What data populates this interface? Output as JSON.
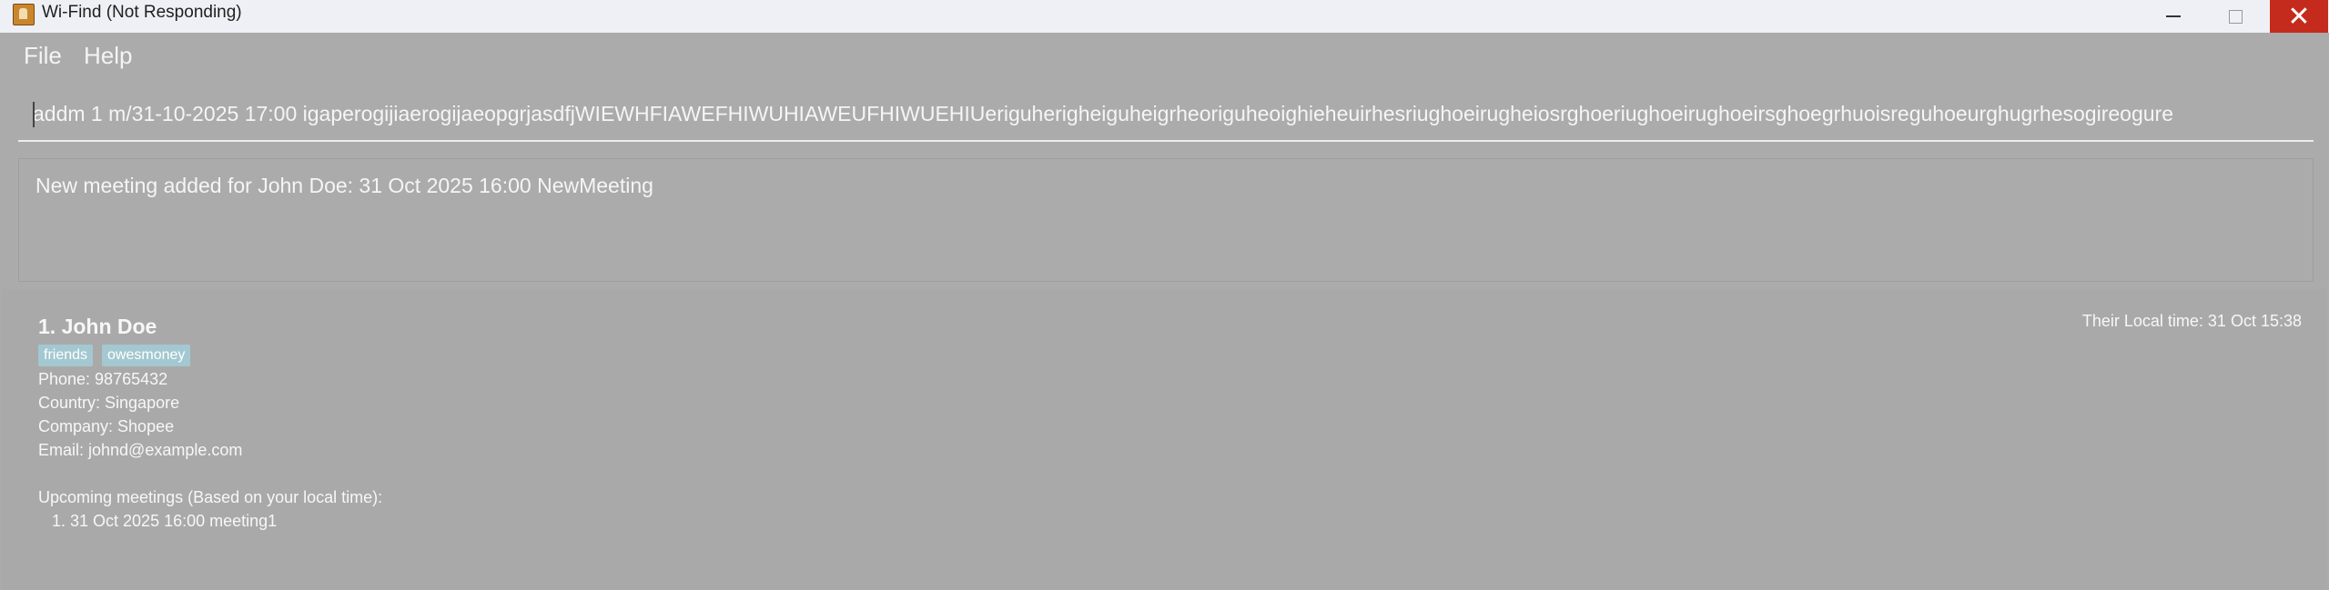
{
  "window": {
    "title": "Wi-Find (Not Responding)",
    "close_glyph": "✕"
  },
  "menu": {
    "file": "File",
    "help": "Help"
  },
  "command": {
    "value": "addm 1 m/31-10-2025 17:00 igaperogijiaerogijaeopgrjasdfjWIEWHFIAWEFHIWUHIAWEUFHIWUEHIUeriguherigheiguheigrheoriguheoighieheuirhesriughoeirugheiosrghoeriughoeirughoeirsghoegrhuoisreguhoeurghugrhesogireogure"
  },
  "result": {
    "message": "New meeting added for John Doe: 31 Oct 2025 16:00 NewMeeting"
  },
  "person": {
    "name": "1. John Doe",
    "local_time": "Their Local time: 31 Oct 15:38",
    "tags": [
      "friends",
      "owesmoney"
    ],
    "phone": "Phone: 98765432",
    "country": "Country: Singapore",
    "company": "Company: Shopee",
    "email": "Email: johnd@example.com",
    "meetings_header": "Upcoming meetings (Based on your local time):",
    "meetings": [
      "1. 31 Oct 2025 16:00 meeting1"
    ]
  },
  "colors": {
    "background": "#ababab",
    "titlebar": "#eef0f5",
    "close_button": "#c42b1c",
    "tag": "#a3c8d1"
  },
  "icons": [
    "app-icon",
    "minimize-icon",
    "maximize-icon",
    "close-icon"
  ]
}
